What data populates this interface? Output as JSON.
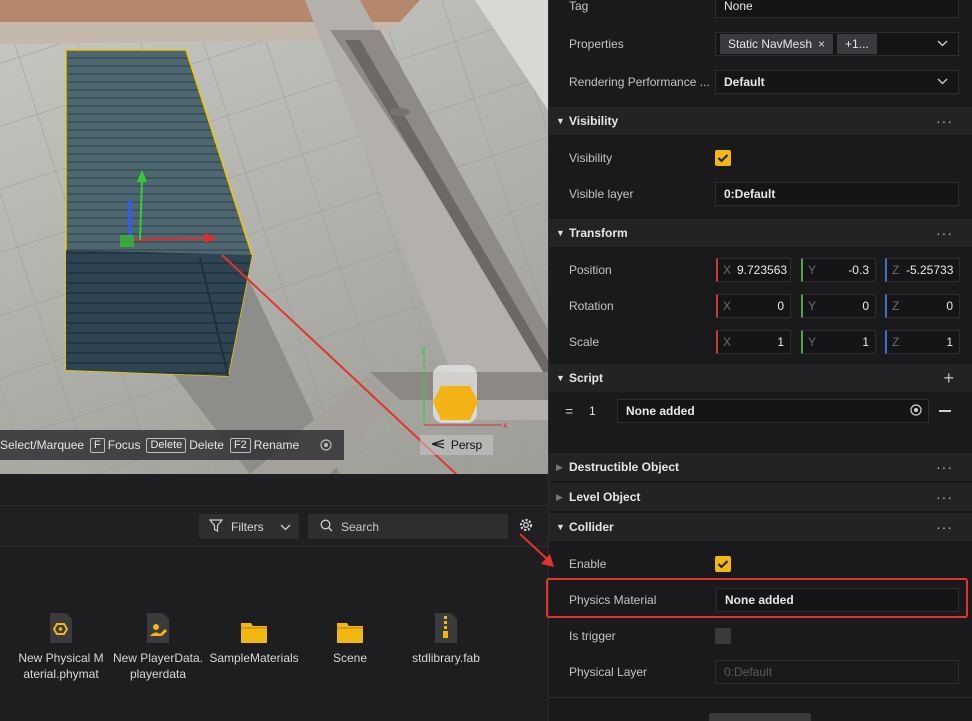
{
  "viewport": {
    "toolbar": {
      "select_label": "Select/Marquee",
      "focus_key": "F",
      "focus_label": "Focus",
      "delete_key": "Delete",
      "delete_label": "Delete",
      "rename_key": "F2",
      "rename_label": "Rename"
    },
    "persp_label": "Persp",
    "axes": {
      "y": "y",
      "x": "x"
    }
  },
  "assets": {
    "filters_label": "Filters",
    "search_placeholder": "Search",
    "items": [
      {
        "name": "New Physical Material.phymat",
        "line1": "New Physical M",
        "line2": "aterial.phymat",
        "icon": "physical-material-icon"
      },
      {
        "name": "New PlayerData.playerdata",
        "line1": "New PlayerData.",
        "line2": "playerdata",
        "icon": "player-data-icon"
      },
      {
        "name": "SampleMaterials",
        "line1": "SampleMaterials",
        "line2": "",
        "icon": "folder-icon"
      },
      {
        "name": "Scene",
        "line1": "Scene",
        "line2": "",
        "icon": "folder-icon"
      },
      {
        "name": "stdlibrary.fab",
        "line1": "stdlibrary.fab",
        "line2": "",
        "icon": "zip-file-icon"
      }
    ]
  },
  "inspector": {
    "tag": {
      "label": "Tag",
      "value": "None"
    },
    "properties": {
      "label": "Properties",
      "chip": "Static NavMesh",
      "more": "+1..."
    },
    "rendering": {
      "label": "Rendering Performance ...",
      "value": "Default"
    },
    "visibility_section": {
      "title": "Visibility"
    },
    "visibility": {
      "label": "Visibility",
      "checked": true
    },
    "visible_layer": {
      "label": "Visible layer",
      "value": "0:Default"
    },
    "transform_section": {
      "title": "Transform"
    },
    "position": {
      "label": "Position",
      "x": "9.723563",
      "y": "-0.3",
      "z": "-5.25733"
    },
    "rotation": {
      "label": "Rotation",
      "x": "0",
      "y": "0",
      "z": "0"
    },
    "scale": {
      "label": "Scale",
      "x": "1",
      "y": "1",
      "z": "1"
    },
    "axis_labels": {
      "x": "X",
      "y": "Y",
      "z": "Z"
    },
    "script_section": {
      "title": "Script"
    },
    "script": {
      "handle": "=",
      "index": "1",
      "value": "None added"
    },
    "destructible_section": {
      "title": "Destructible Object"
    },
    "level_section": {
      "title": "Level Object"
    },
    "collider_section": {
      "title": "Collider"
    },
    "enable": {
      "label": "Enable",
      "checked": true
    },
    "physics_material": {
      "label": "Physics Material",
      "value": "None added"
    },
    "is_trigger": {
      "label": "Is trigger",
      "checked": false
    },
    "physical_layer": {
      "label": "Physical Layer",
      "placeholder": "0:Default"
    },
    "more_label": "···"
  },
  "colors": {
    "accent": "#f2b712",
    "highlight": "#e5332a",
    "selection_outline": "#f5c400"
  }
}
